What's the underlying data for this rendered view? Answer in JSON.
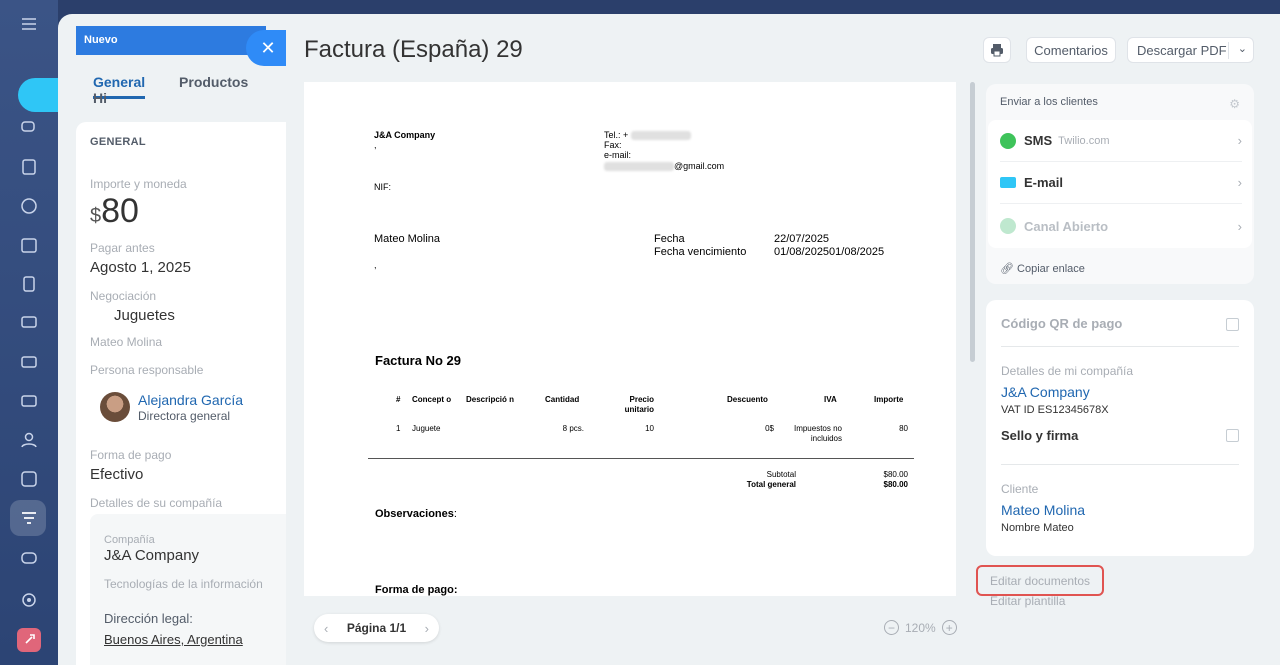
{
  "background_card": {
    "stage": "Nuevo",
    "tabs": [
      "General",
      "Productos",
      "Hi"
    ],
    "section": "GENERAL",
    "amount_label": "Importe y moneda",
    "currency": "$",
    "amount": "80",
    "due_label": "Pagar antes",
    "due": "Agosto 1, 2025",
    "deal_label": "Negociación",
    "deal": "Juguetes",
    "contact": "Mateo Molina",
    "responsible_label": "Persona responsable",
    "responsible_name": "Alejandra García",
    "responsible_role": "Directora general",
    "payment_label": "Forma de pago",
    "payment": "Efectivo",
    "company_details_label": "Detalles de su compañía",
    "company_label": "Compañía",
    "company": "J&A Company",
    "industry": "Tecnologías de la información",
    "address_label": "Dirección legal:",
    "address": "Buenos Aires, Argentina"
  },
  "slider": {
    "title": "Factura (España) 29",
    "comments_btn": "Comentarios",
    "download_btn": "Descargar PDF"
  },
  "document": {
    "company": "J&A Company",
    "company_sub": ",",
    "nif": "NIF:",
    "tel": "Tel.: +",
    "fax": "Fax:",
    "email": "e-mail:",
    "email_domain": "@gmail.com",
    "client": "Mateo Molina",
    "client_sub": ",",
    "date_label": "Fecha",
    "due_label": "Fecha vencimiento",
    "date": "22/07/2025",
    "due": "01/08/202501/08/2025",
    "invoice_title": "Factura No 29",
    "headers": [
      "#",
      "Concept o",
      "Descripció n",
      "Cantidad",
      "Precio unitario",
      "Descuento",
      "IVA",
      "Importe"
    ],
    "row": [
      "1",
      "Juguete",
      "",
      "8 pcs.",
      "10",
      "0$",
      "Impuestos no incluidos",
      "80"
    ],
    "subtotal_label": "Subtotal",
    "subtotal": "$80.00",
    "total_label": "Total general",
    "total": "$80.00",
    "notes": "Observaciones",
    "payment": "Forma de pago:"
  },
  "pager": {
    "label": "Página 1/1",
    "zoom": "120%"
  },
  "send": {
    "header": "Enviar a los clientes",
    "items": [
      {
        "label": "SMS",
        "note": "Twilio.com",
        "color": "#3ec35a"
      },
      {
        "label": "E-mail",
        "note": "",
        "color": "#2fc6f6"
      },
      {
        "label": "Canal Abierto",
        "note": "",
        "color": "#bfe8cf"
      }
    ],
    "copy_link": "Copiar enlace"
  },
  "info": {
    "qr": "Código QR de pago",
    "my_company_label": "Detalles de mi compañía",
    "my_company": "J&A Company",
    "vat": "VAT ID ES12345678X",
    "stamp": "Sello y firma",
    "client_label": "Cliente",
    "client": "Mateo Molina",
    "client_name": "Nombre Mateo"
  },
  "actions": {
    "edit_docs": "Editar documentos",
    "edit_template": "Editar plantilla"
  },
  "colors": {
    "accent": "#2067b0",
    "highlight": "#e05451",
    "stage": "#2d7be0"
  }
}
